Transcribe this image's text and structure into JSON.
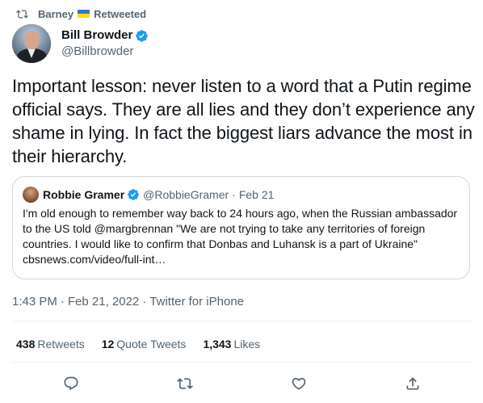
{
  "retweet": {
    "icon": "retweet-icon",
    "user": "Barney",
    "flag": "ukraine-flag-icon",
    "label": "Retweeted"
  },
  "author": {
    "name": "Bill Browder",
    "handle": "@Billbrowder",
    "verified_icon": "verified-badge-icon"
  },
  "tweet": {
    "text": "Important lesson: never listen to a word that a Putin regime official says. They are all lies and they don’t experience any shame in lying. In fact the biggest liars advance the most in their hierarchy."
  },
  "quote": {
    "name": "Robbie Gramer",
    "handle": "@RobbieGramer",
    "dot": "·",
    "date": "Feb 21",
    "text": "I'm old enough to remember way back to 24 hours ago, when the Russian ambassador to the US told @margbrennan \"We are not trying to take any territories of foreign countries. I would like to confirm that Donbas and Luhansk is a part of Ukraine\" cbsnews.com/video/full-int…"
  },
  "meta": {
    "time": "1:43 PM",
    "sep1": "·",
    "date": "Feb 21, 2022",
    "sep2": "·",
    "source": "Twitter for iPhone"
  },
  "stats": {
    "retweets_count": "438",
    "retweets_label": "Retweets",
    "quotes_count": "12",
    "quotes_label": "Quote Tweets",
    "likes_count": "1,343",
    "likes_label": "Likes"
  },
  "actions": [
    "reply-icon",
    "retweet-icon",
    "like-icon",
    "share-icon"
  ],
  "colors": {
    "text": "#0f1419",
    "secondary": "#536471",
    "verified": "#1d9bf0",
    "border": "#cfd9de"
  }
}
